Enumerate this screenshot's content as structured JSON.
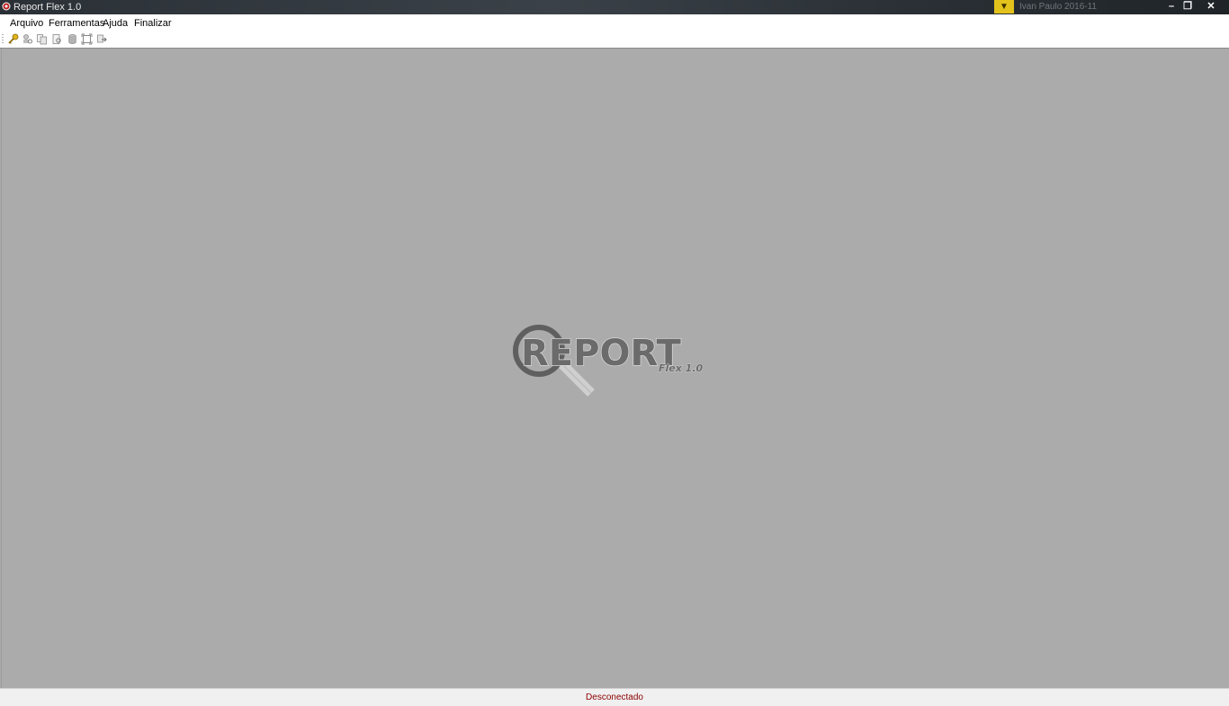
{
  "window": {
    "title": "Report Flex 1.0",
    "tray_text": "Ivan Paulo 2016-11",
    "minimize_glyph": "–",
    "restore_glyph": "❐",
    "close_glyph": "✕",
    "app_icon": "app-icon"
  },
  "menu": {
    "items": [
      "Arquivo",
      "Ferramentas",
      "Ajuda",
      "Finalizar"
    ]
  },
  "toolbar": {
    "tools": [
      "key-icon",
      "user-search-icon",
      "copy-icon",
      "document-search-icon",
      "database-icon",
      "expand-icon",
      "exit-icon"
    ]
  },
  "logo": {
    "main_text": "REPORT",
    "sub_text": "Flex 1.0"
  },
  "status": {
    "text": "Desconectado",
    "color": "#8b0000"
  }
}
